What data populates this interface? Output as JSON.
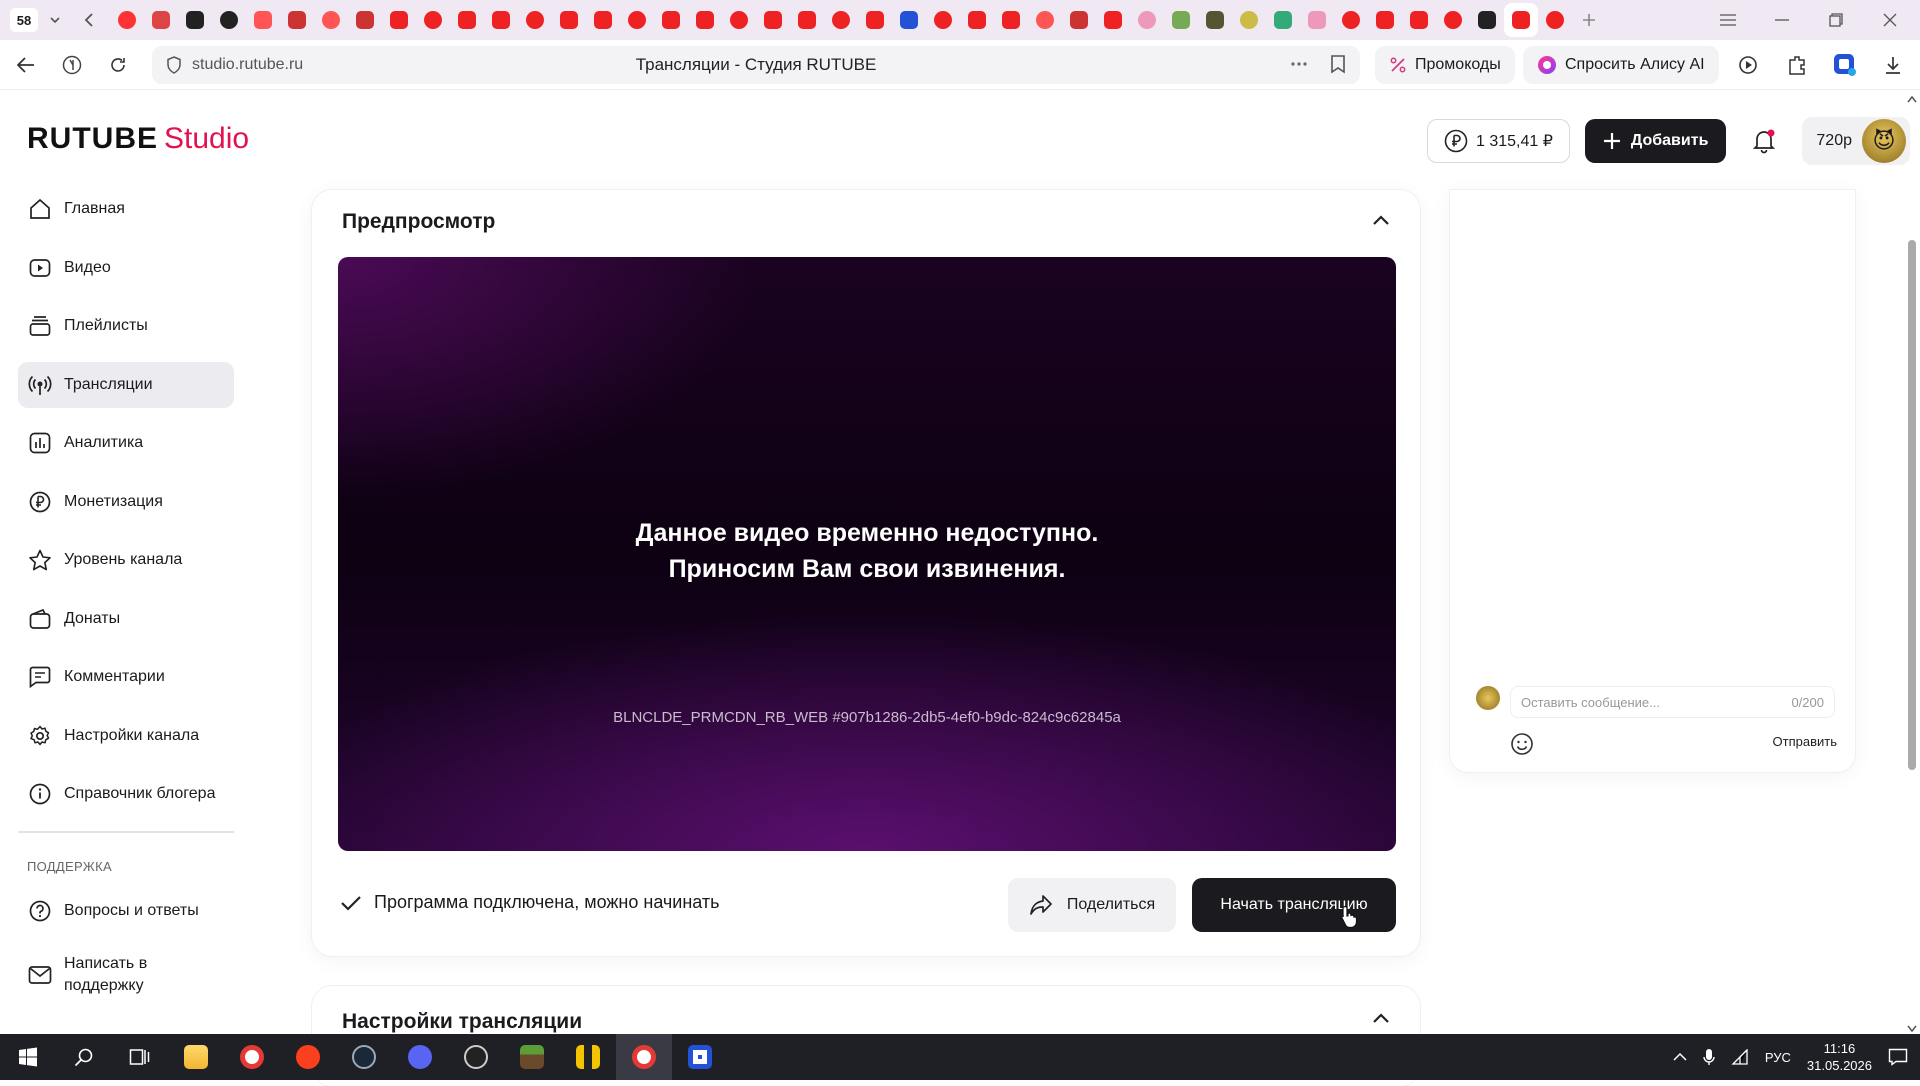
{
  "browser": {
    "tab_count": "58",
    "url": "studio.rutube.ru",
    "page_title": "Трансляции - Студия RUTUBE",
    "promo_label": "Промокоды",
    "alice_label": "Спросить Алису AI"
  },
  "header": {
    "logo_main": "RUTUBE",
    "logo_sub": "Studio",
    "balance": "1 315,41 ₽",
    "add_label": "Добавить",
    "user_quality": "720p"
  },
  "sidebar": {
    "items": [
      {
        "label": "Главная",
        "icon": "home-icon"
      },
      {
        "label": "Видео",
        "icon": "video-icon"
      },
      {
        "label": "Плейлисты",
        "icon": "playlist-icon"
      },
      {
        "label": "Трансляции",
        "icon": "broadcast-icon"
      },
      {
        "label": "Аналитика",
        "icon": "analytics-icon"
      },
      {
        "label": "Монетизация",
        "icon": "ruble-icon"
      },
      {
        "label": "Уровень канала",
        "icon": "star-icon"
      },
      {
        "label": "Донаты",
        "icon": "wallet-icon"
      },
      {
        "label": "Комментарии",
        "icon": "comment-icon"
      },
      {
        "label": "Настройки канала",
        "icon": "gear-icon"
      },
      {
        "label": "Справочник блогера",
        "icon": "info-icon"
      }
    ],
    "support_label": "ПОДДЕРЖКА",
    "support_items": [
      {
        "label": "Вопросы и ответы",
        "icon": "question-icon"
      },
      {
        "label": "Написать в поддержку",
        "icon": "mail-icon"
      }
    ]
  },
  "preview": {
    "title": "Предпросмотр",
    "video_message_line1": "Данное видео временно недоступно.",
    "video_message_line2": "Приносим Вам свои извинения.",
    "video_error_code": "BLNCLDE_PRMCDN_RB_WEB #907b1286-2db5-4ef0-b9dc-824c9c62845a",
    "status_text": "Программа подключена, можно начинать",
    "share_label": "Поделиться",
    "start_label": "Начать трансляцию"
  },
  "settings": {
    "title": "Настройки трансляции"
  },
  "chat": {
    "placeholder": "Оставить сообщение...",
    "counter": "0/200",
    "send_label": "Отправить"
  },
  "taskbar": {
    "lang": "РУС",
    "time": "11:16",
    "date": "31.05.2026"
  },
  "colors": {
    "accent": "#e4114f",
    "dark_button": "#1b1b1f",
    "active_nav": "#ececf0"
  }
}
